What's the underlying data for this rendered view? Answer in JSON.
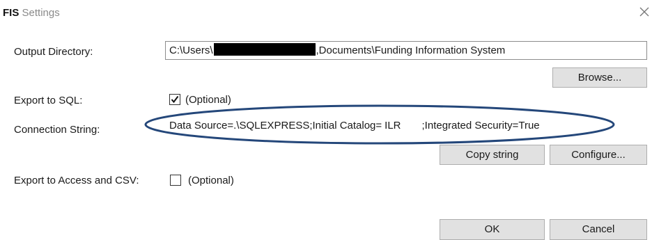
{
  "window": {
    "title_app": "FIS",
    "title_rest": " Settings"
  },
  "output_directory": {
    "label": "Output Directory:",
    "value_prefix": "C:\\Users\\",
    "value_suffix": ",Documents\\Funding Information System",
    "browse_label": "Browse..."
  },
  "export_sql": {
    "label": "Export to SQL:",
    "checked": true,
    "optional_label": "(Optional)"
  },
  "connection_string": {
    "label": "Connection String:",
    "part1": "Data Source=.\\SQLEXPRESS;Initial Catalog=",
    "catalog": "ILR",
    "part2": ";Integrated Security=True",
    "copy_label": "Copy string",
    "configure_label": "Configure..."
  },
  "export_access": {
    "label": "Export to Access and CSV:",
    "checked": false,
    "optional_label": "(Optional)"
  },
  "footer": {
    "ok_label": "OK",
    "cancel_label": "Cancel"
  },
  "colors": {
    "highlight_ellipse": "#24477a"
  }
}
